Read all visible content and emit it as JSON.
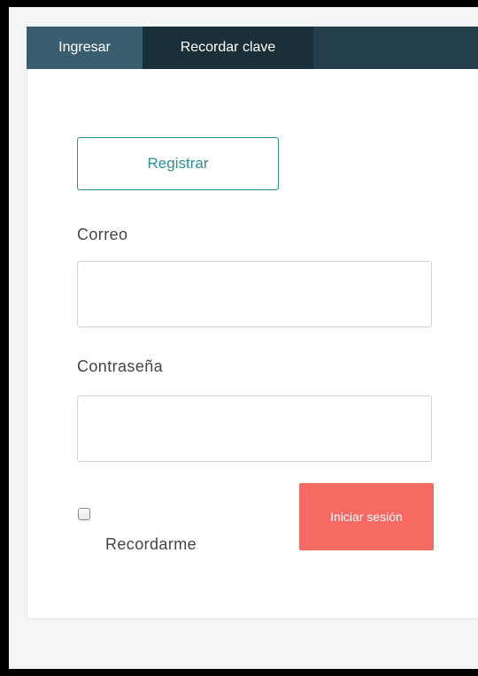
{
  "tabs": {
    "login_label": "Ingresar",
    "remember_label": "Recordar clave"
  },
  "form": {
    "register_label": "Registrar",
    "email_label": "Correo",
    "email_value": "",
    "password_label": "Contraseña",
    "password_value": "",
    "remember_label": "Recordarme",
    "remember_checked": false,
    "submit_label": "Iniciar sesión"
  },
  "colors": {
    "tabbar": "#243f4b",
    "tab_login": "#3a5d6f",
    "tab_remember": "#1b2f38",
    "accent": "#2b8f98",
    "submit": "#f76a63"
  }
}
